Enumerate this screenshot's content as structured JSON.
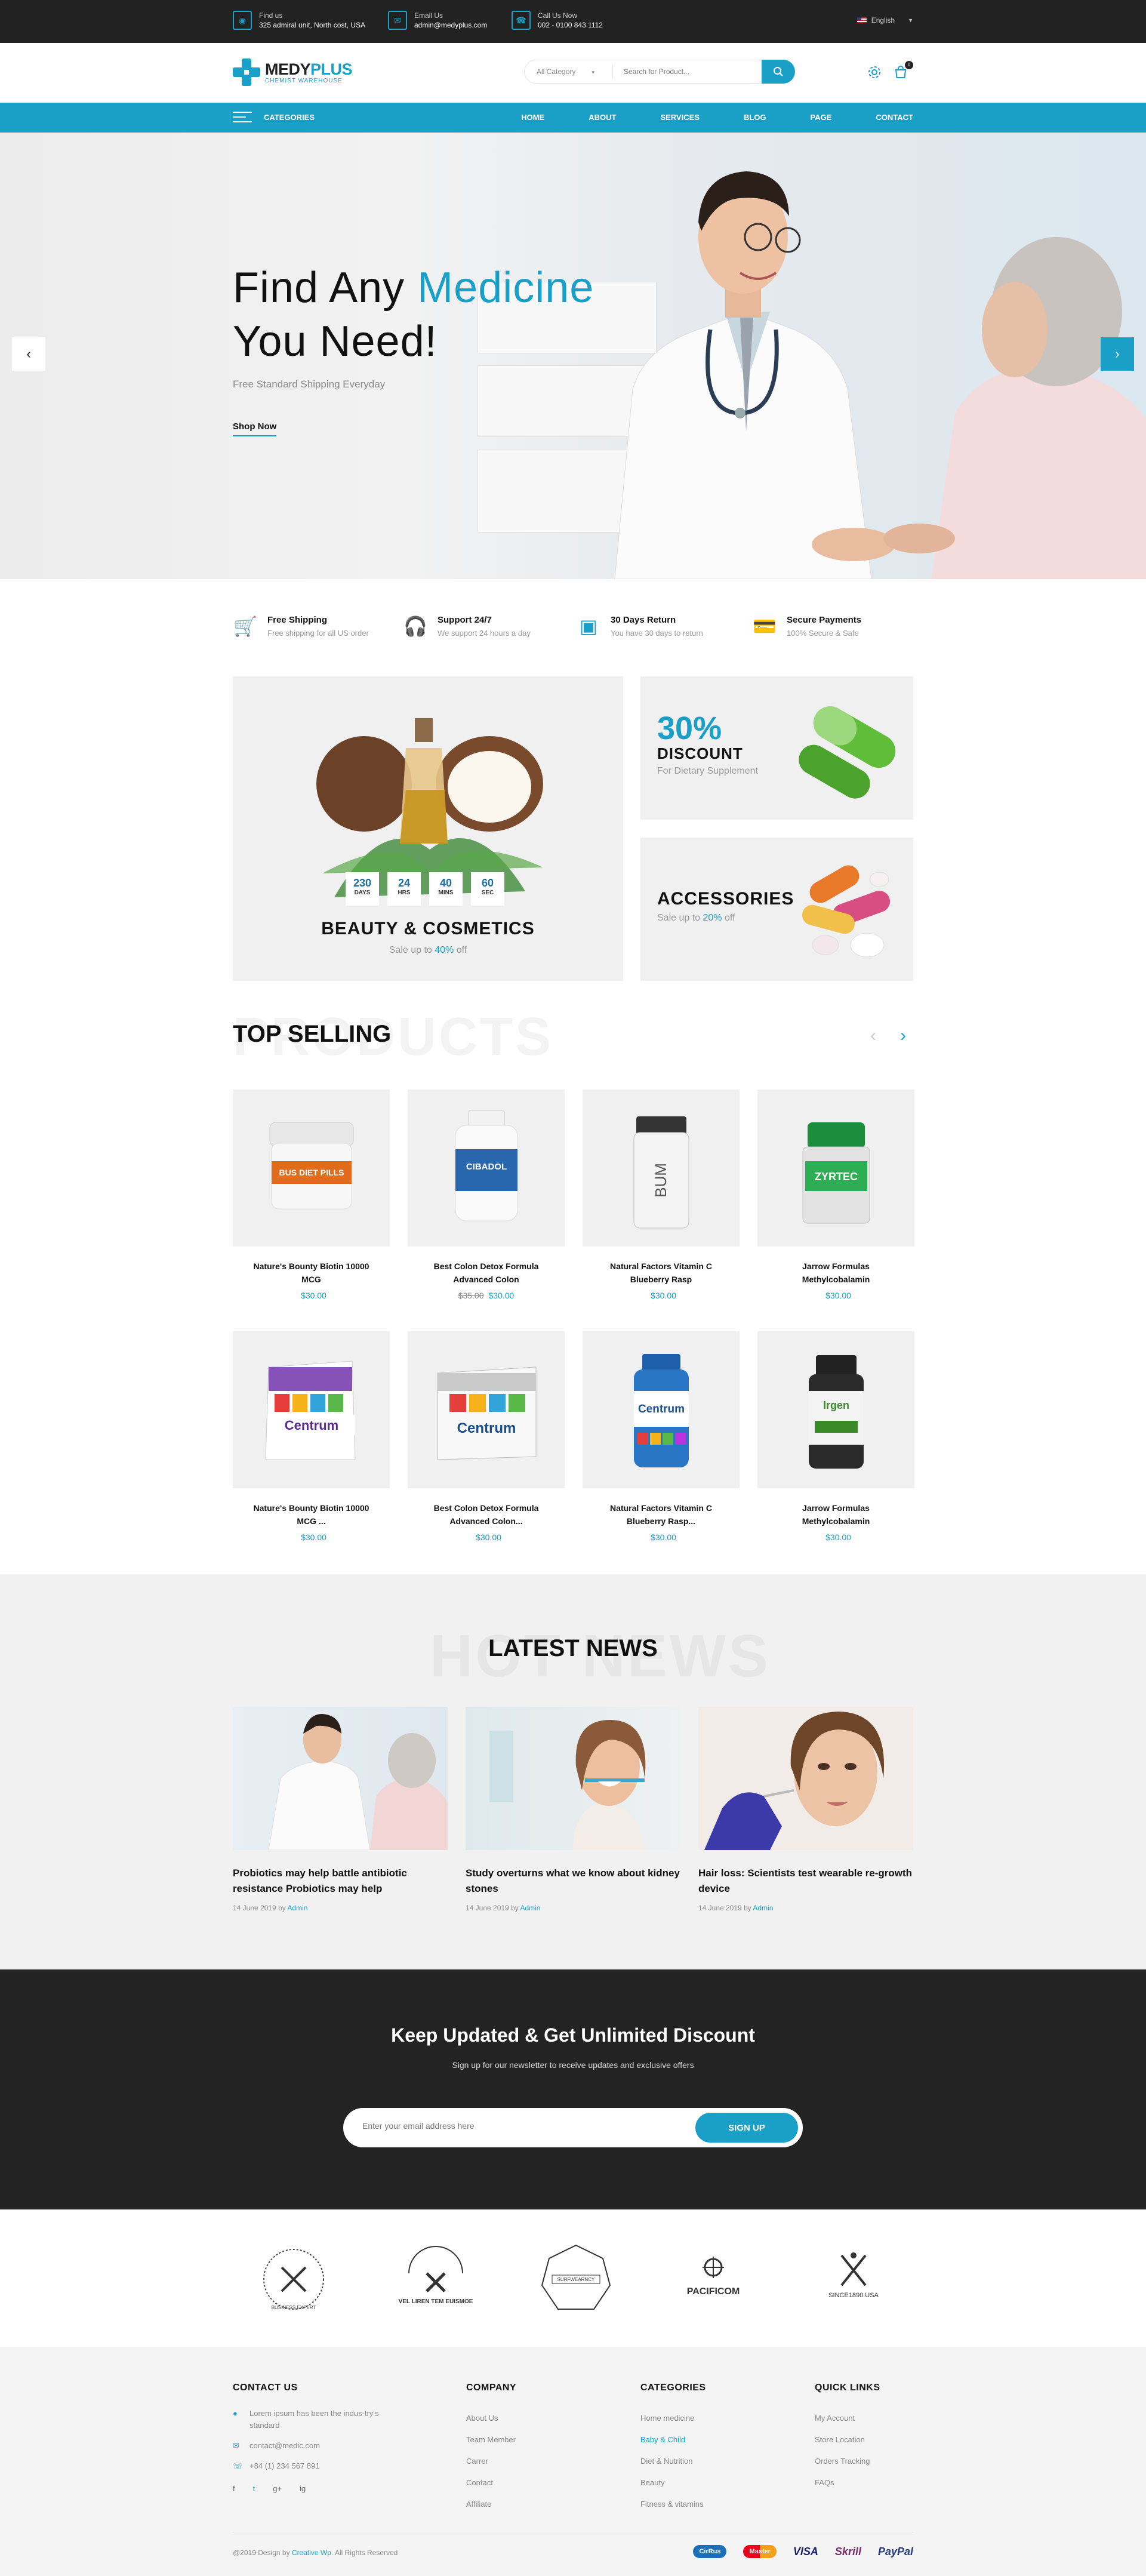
{
  "topbar": {
    "find_label": "Find us",
    "find_value": "325 admiral unit, North cost, USA",
    "email_label": "Email Us",
    "email_value": "admin@medyplus.com",
    "call_label": "Call Us Now",
    "call_value": "002 - 0100 843 1112",
    "language": "English"
  },
  "header": {
    "logo_main": "MEDY",
    "logo_accent": "PLUS",
    "logo_sub": "CHEMIST WAREHOUSE",
    "category_select": "All Category",
    "search_placeholder": "Search for Product...",
    "cart_count": "0"
  },
  "nav": {
    "categories": "CATEGORIES",
    "links": [
      "HOME",
      "ABOUT",
      "SERVICES",
      "BLOG",
      "PAGE",
      "CONTACT"
    ]
  },
  "hero": {
    "title_a": "Find Any ",
    "title_hl": "Medicine",
    "title_b": "You Need!",
    "subtitle": "Free Standard Shipping Everyday",
    "cta": "Shop Now"
  },
  "features": [
    {
      "title": "Free Shipping",
      "sub": "Free shipping for all US order"
    },
    {
      "title": "Support 24/7",
      "sub": "We support 24 hours a day"
    },
    {
      "title": "30 Days Return",
      "sub": "You have 30 days to return"
    },
    {
      "title": "Secure Payments",
      "sub": "100% Secure & Safe"
    }
  ],
  "banners": {
    "beauty": {
      "title": "BEAUTY & COSMETICS",
      "sub_a": "Sale up to ",
      "sub_hl": "40%",
      "sub_b": " off",
      "countdown": [
        {
          "n": "230",
          "u": "DAYS"
        },
        {
          "n": "24",
          "u": "HRS"
        },
        {
          "n": "40",
          "u": "MINS"
        },
        {
          "n": "60",
          "u": "SEC"
        }
      ]
    },
    "discount": {
      "big": "30%",
      "title": "DISCOUNT",
      "sub": "For Dietary Supplement"
    },
    "accessories": {
      "title": "ACCESSORIES",
      "sub_a": "Sale up to ",
      "sub_hl": "20%",
      "sub_b": " off"
    }
  },
  "top_selling": {
    "bg_text": "PRODUCTS",
    "title": "TOP SELLING",
    "products": [
      {
        "name": "Nature's Bounty Biotin 10000 MCG",
        "old": "",
        "price": "$30.00"
      },
      {
        "name": "Best Colon Detox Formula Advanced Colon",
        "old": "$35.00",
        "price": "$30.00"
      },
      {
        "name": "Natural Factors Vitamin C Blueberry Rasp",
        "old": "",
        "price": "$30.00"
      },
      {
        "name": "Jarrow Formulas Methylcobalamin",
        "old": "",
        "price": "$30.00"
      },
      {
        "name": "Nature's Bounty Biotin 10000 MCG ...",
        "old": "",
        "price": "$30.00"
      },
      {
        "name": "Best Colon Detox Formula Advanced Colon...",
        "old": "",
        "price": "$30.00"
      },
      {
        "name": "Natural Factors Vitamin C Blueberry Rasp...",
        "old": "",
        "price": "$30.00"
      },
      {
        "name": "Jarrow Formulas Methylcobalamin",
        "old": "",
        "price": "$30.00"
      }
    ],
    "labels": [
      "BUS DIET PILLS",
      "CIBADOL",
      "BUM",
      "ZYRTEC",
      "Centrum",
      "Centrum",
      "Centrum",
      "Irgen"
    ]
  },
  "news": {
    "bg_text": "HOT NEWS",
    "title": "LATEST NEWS",
    "items": [
      {
        "title": "Probiotics may help battle antibiotic resistance Probiotics may help",
        "date": "14 June 2019 by ",
        "author": "Admin"
      },
      {
        "title": "Study overturns what we know about kidney stones",
        "date": "14 June 2019 by ",
        "author": "Admin"
      },
      {
        "title": "Hair loss: Scientists test wearable re-growth device",
        "date": "14 June 2019 by ",
        "author": "Admin"
      }
    ]
  },
  "newsletter": {
    "title": "Keep Updated & Get Unlimited Discount",
    "sub": "Sign up for our newsletter to receive updates and exclusive offers",
    "placeholder": "Enter your email address here",
    "button": "SIGN UP"
  },
  "brands": [
    "BUSINESS EXPERT",
    "VEL LIREN TEM EUISMOE",
    "SURFWEARNCY",
    "PACIFICOM",
    "SINCE1890.USA"
  ],
  "footer": {
    "contact": {
      "heading": "CONTACT US",
      "address": "Lorem ipsum has been the indus-try's standard",
      "email": "contact@medic.com",
      "phone": "+84 (1) 234 567 891",
      "social": [
        "f",
        "t",
        "g+",
        "ig"
      ]
    },
    "company": {
      "heading": "COMPANY",
      "links": [
        "About Us",
        "Team Member",
        "Carrer",
        "Contact",
        "Affiliate"
      ]
    },
    "categories": {
      "heading": "CATEGORIES",
      "links": [
        "Home medicine",
        "Baby & Child",
        "Diet & Nutrition",
        "Beauty",
        "Fitness & vitamins"
      ]
    },
    "quick": {
      "heading": "QUICK LINKS",
      "links": [
        "My Account",
        "Store Location",
        "Orders Tracking",
        "FAQs"
      ]
    },
    "copyright_a": "@2019 Design by ",
    "copyright_author": "Creative Wp",
    "copyright_b": ". All Rights Reserved",
    "payments": [
      "CirRus",
      "Master",
      "VISA",
      "Skrill",
      "PayPal"
    ]
  },
  "colors": {
    "accent": "#1a9fc7",
    "dark": "#222222",
    "light": "#f0f0f0"
  }
}
